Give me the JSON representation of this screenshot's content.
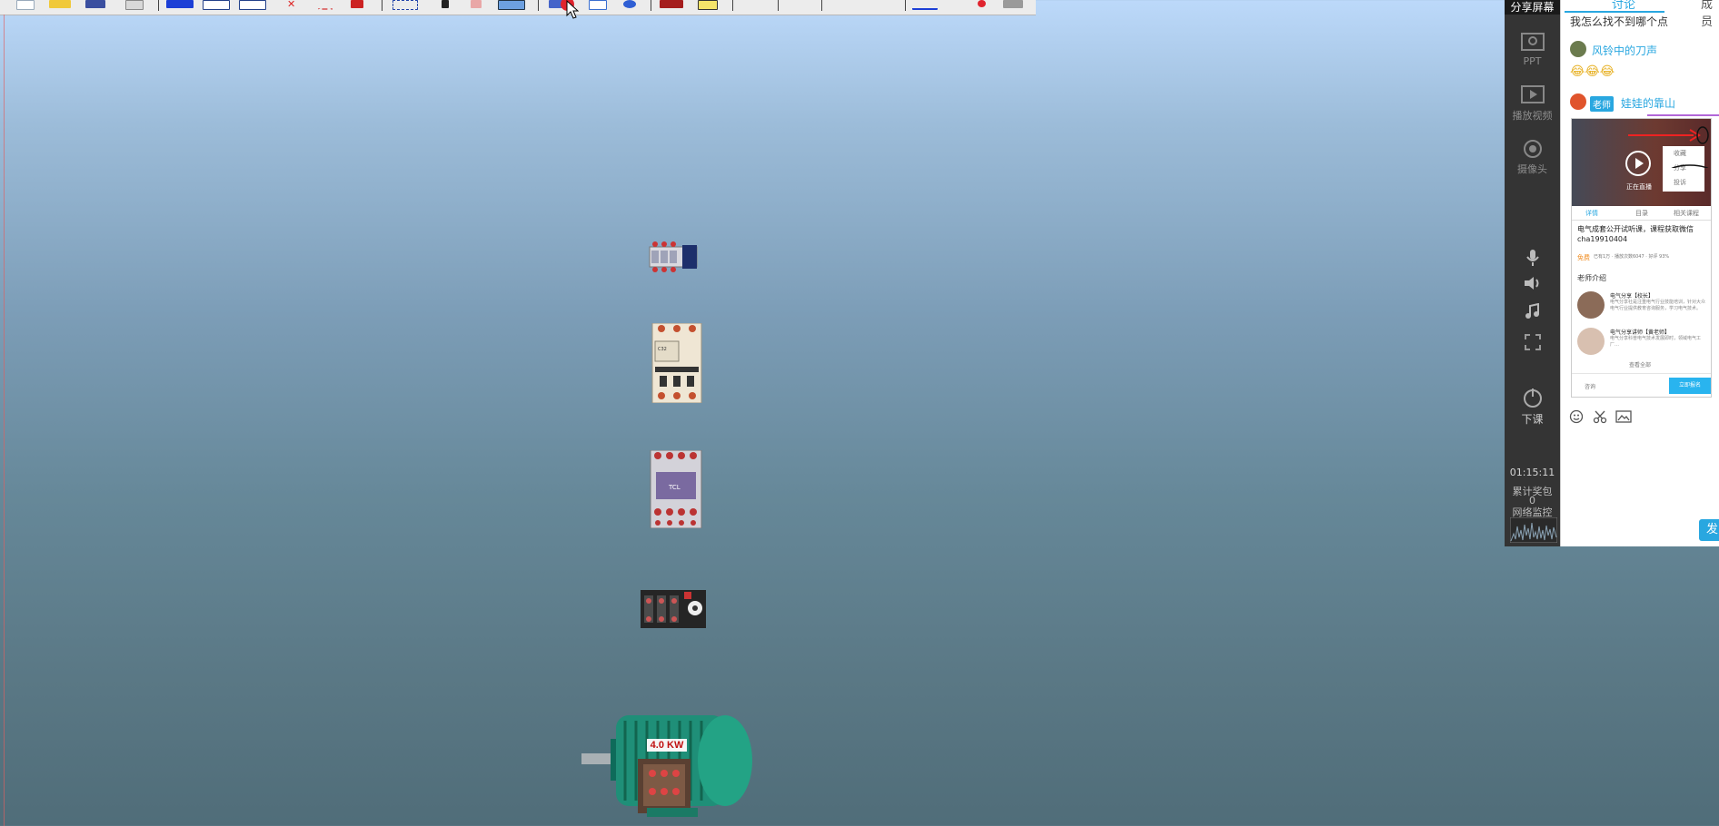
{
  "toolbar": {
    "icons": [
      "new-icon",
      "open-folder-icon",
      "save-icon",
      "copy-icon",
      "blue-box-icon",
      "grid-icon",
      "table-icon",
      "delete-x-icon",
      "connect-icon",
      "palette-icon",
      "select-rect-icon",
      "pen-icon",
      "eraser-icon",
      "image-icon",
      "record-icon",
      "frame-icon",
      "zoom-icon",
      "stamp-icon",
      "note-icon",
      "blue-line-icon",
      "red-dot-icon",
      "settings-icon"
    ]
  },
  "canvas": {
    "motor_label": "4.0 KW"
  },
  "rail": {
    "share_screen": "分享屏幕",
    "ppt": "PPT",
    "play_video": "播放视频",
    "camera": "摄像头",
    "end_class": "下课",
    "timer": "01:15:11",
    "red_packets_label": "累计奖包",
    "red_packets_count": "0",
    "network_label": "网络监控"
  },
  "panel": {
    "tab_discuss": "讨论",
    "tab_more": "成员",
    "msg_top": "我怎么找不到哪个点",
    "user1": "风铃中的刀声",
    "emojis": "😂😂😂",
    "teacher_badge": "老师",
    "user2": "娃娃的靠山",
    "shot_tabs": [
      "详情",
      "目录",
      "相关课程"
    ],
    "shot_title": "电气成套公开试听课，课程获取微信cha19910404",
    "shot_free": "免费",
    "shot_meta": "已有1万 · 播放次数6047 · 好评 93%",
    "shot_live": "正在直播",
    "shot_menu": [
      "收藏",
      "分享",
      "投诉"
    ],
    "shot_teacher_head": "老师介绍",
    "teacher1_name": "电气分享【校长】",
    "teacher1_desc": "电气分享社是注重电气行业技能培训，针对大众电气行业提供教育咨询服务，学习电气技术。",
    "teacher2_name": "电气分享讲师【黄老师】",
    "teacher2_desc": "电气分享科普电气技术发展即时，领域电气工厂…",
    "view_all": "查看全部",
    "consult": "咨询",
    "enroll": "立即报名",
    "send": "发"
  }
}
